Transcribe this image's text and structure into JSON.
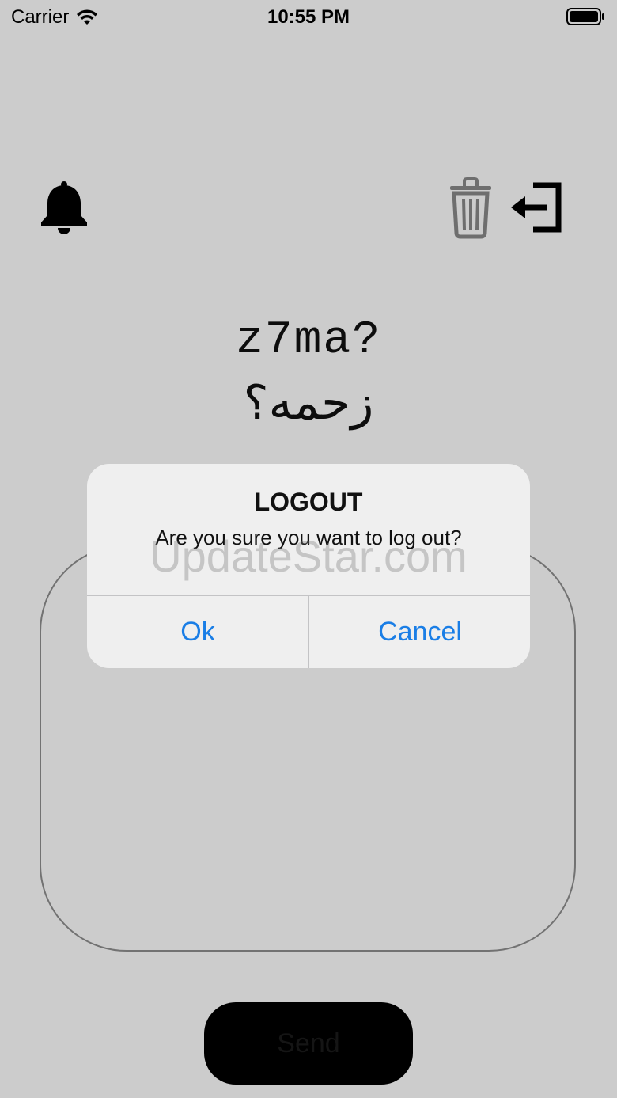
{
  "status_bar": {
    "carrier": "Carrier",
    "time": "10:55 PM",
    "icons": [
      "wifi-icon",
      "battery-icon"
    ]
  },
  "toolbar": {
    "left_icon": "bell-icon",
    "right_icons": [
      "trash-icon",
      "logout-icon"
    ]
  },
  "header": {
    "title_latin": "z7ma?",
    "title_arabic": "زحمه؟"
  },
  "composer": {
    "message_text": "",
    "send_label": "Send"
  },
  "alert": {
    "title": "LOGOUT",
    "message": "Are you sure you want to log out?",
    "ok_label": "Ok",
    "cancel_label": "Cancel"
  },
  "watermark": "UpdateStar.com",
  "colors": {
    "accent": "#1a7ee6",
    "alert_background": "#efefef",
    "send_button": "#000000",
    "trash_icon": "#8a8a8a"
  }
}
